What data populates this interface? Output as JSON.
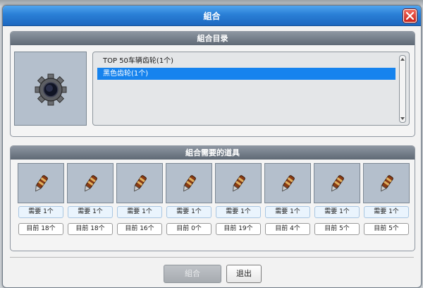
{
  "dialog": {
    "title": "組合"
  },
  "catalog": {
    "header": "組合目录",
    "items": [
      {
        "label": "TOP 50车辆齿轮(1个)",
        "selected": false
      },
      {
        "label": "黑色齿轮(1个)",
        "selected": true
      }
    ]
  },
  "materials": {
    "header": "組合需要的道具",
    "items": [
      {
        "need": "需要 1个",
        "current": "目前 18个"
      },
      {
        "need": "需要 1个",
        "current": "目前 18个"
      },
      {
        "need": "需要 1个",
        "current": "目前 16个"
      },
      {
        "need": "需要 1个",
        "current": "目前 0个"
      },
      {
        "need": "需要 1个",
        "current": "目前 19个"
      },
      {
        "need": "需要 1个",
        "current": "目前 4个"
      },
      {
        "need": "需要 1个",
        "current": "目前 5个"
      },
      {
        "need": "需要 1个",
        "current": "目前 5个"
      }
    ],
    "icon": "tool-item-icon"
  },
  "buttons": {
    "combine": "組合",
    "exit": "退出"
  },
  "colors": {
    "titlebar": "#2a7fd6",
    "selection": "#1683ee",
    "slot": "#b4bfcc"
  }
}
